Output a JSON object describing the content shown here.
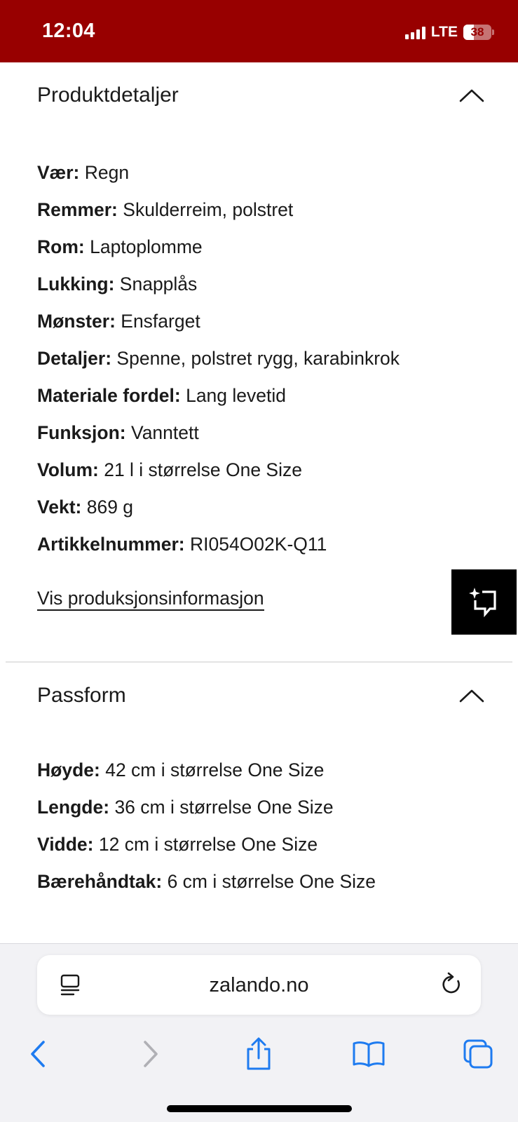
{
  "status_bar": {
    "time": "12:04",
    "network": "LTE",
    "battery": "38",
    "battery_level": 0.38
  },
  "product_details": {
    "title": "Produktdetaljer",
    "items": [
      {
        "key": "Vær:",
        "value": "Regn"
      },
      {
        "key": "Remmer:",
        "value": "Skulderreim, polstret"
      },
      {
        "key": "Rom:",
        "value": "Laptoplomme"
      },
      {
        "key": "Lukking:",
        "value": "Snapplås"
      },
      {
        "key": "Mønster:",
        "value": "Ensfarget"
      },
      {
        "key": "Detaljer:",
        "value": "Spenne, polstret rygg, karabinkrok"
      },
      {
        "key": "Materiale fordel:",
        "value": "Lang levetid"
      },
      {
        "key": "Funksjon:",
        "value": "Vanntett"
      },
      {
        "key": "Volum:",
        "value": "21 l i størrelse One Size"
      },
      {
        "key": "Vekt:",
        "value": "869 g"
      },
      {
        "key": "Artikkelnummer:",
        "value": "RI054O02K-Q11"
      }
    ],
    "link": "Vis produksjonsinformasjon"
  },
  "fit": {
    "title": "Passform",
    "items": [
      {
        "key": "Høyde:",
        "value": "42 cm i størrelse One Size"
      },
      {
        "key": "Lengde:",
        "value": "36 cm i størrelse One Size"
      },
      {
        "key": "Vidde:",
        "value": "12 cm i størrelse One Size"
      },
      {
        "key": "Bærehåndtak:",
        "value": "6 cm i størrelse One Size"
      }
    ]
  },
  "browser": {
    "url": "zalando.no",
    "icons": [
      "reader-icon",
      "reload-icon",
      "back-icon",
      "forward-icon",
      "share-icon",
      "bookmarks-icon",
      "tabs-icon"
    ]
  },
  "colors": {
    "brand_red": "#980000",
    "ios_blue": "#1e7bf0",
    "text": "#1a1a1a"
  }
}
